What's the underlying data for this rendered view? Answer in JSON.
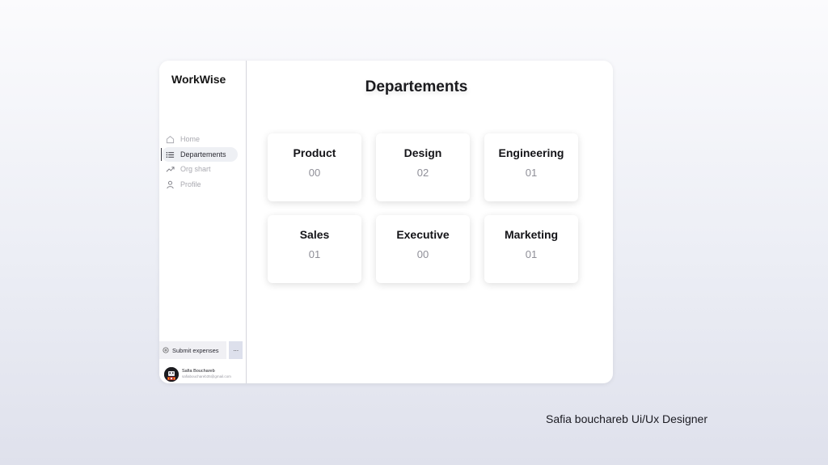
{
  "app": {
    "brand": "WorkWise"
  },
  "sidebar": {
    "items": [
      {
        "label": "Home",
        "icon": "home-icon",
        "active": false
      },
      {
        "label": "Departements",
        "icon": "list-icon",
        "active": true
      },
      {
        "label": "Org shart",
        "icon": "trending-up-icon",
        "active": false
      },
      {
        "label": "Profile",
        "icon": "user-icon",
        "active": false
      }
    ],
    "submit_label": "Submit expenses",
    "more_label": "···",
    "user": {
      "name": "Safia Bouchareb",
      "email": "safiabouchareb35@gmail.com"
    }
  },
  "main": {
    "title": "Departements",
    "departments": [
      {
        "name": "Product",
        "count": "00"
      },
      {
        "name": "Design",
        "count": "02"
      },
      {
        "name": "Engineering",
        "count": "01"
      },
      {
        "name": "Sales",
        "count": "01"
      },
      {
        "name": "Executive",
        "count": "00"
      },
      {
        "name": "Marketing",
        "count": "01"
      }
    ]
  },
  "credit": "Safia bouchareb Ui/Ux Designer",
  "colors": {
    "accent": "#2b2b33",
    "active_bg": "#eef0f4",
    "more_button_bg": "#dde0ec",
    "muted_text": "#a9a9b0"
  }
}
